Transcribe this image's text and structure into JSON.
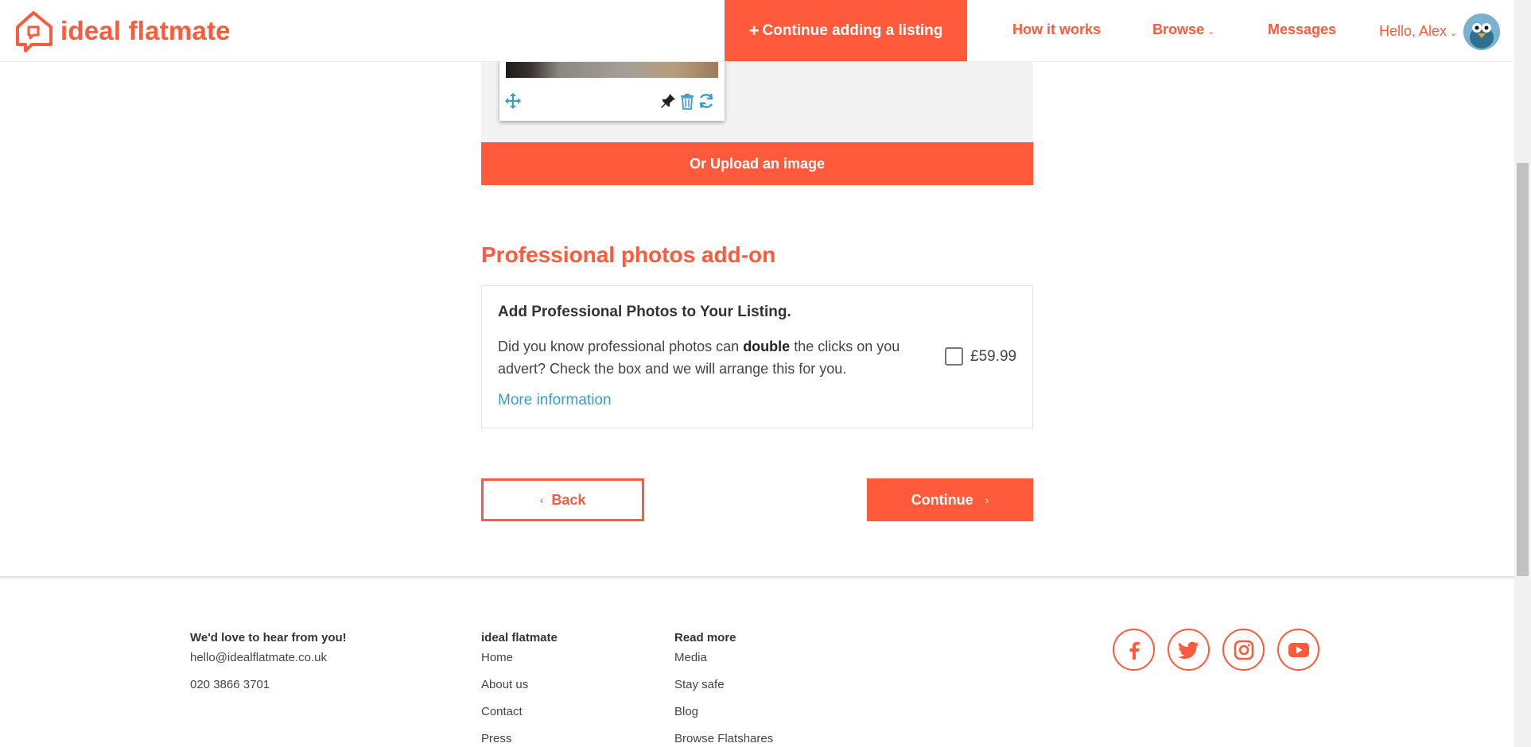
{
  "header": {
    "logo_text": "ideal flatmate",
    "cta_label": "Continue adding a listing",
    "nav": {
      "how_it_works": "How it works",
      "browse": "Browse",
      "messages": "Messages"
    },
    "greeting": "Hello, Alex"
  },
  "photo_upload": {
    "upload_label": "Or Upload an image"
  },
  "addon": {
    "section_title": "Professional photos add-on",
    "heading": "Add Professional Photos to Your Listing.",
    "desc_pre": "Did you know professional photos can ",
    "desc_bold": "double",
    "desc_post": " the clicks on you advert? Check the box and we will arrange this for you.",
    "more_info": "More information",
    "price": "£59.99",
    "checked": false
  },
  "actions": {
    "back_label": "Back",
    "continue_label": "Continue"
  },
  "footer": {
    "contact": {
      "heading": "We'd love to hear from you!",
      "email": "hello@idealflatmate.co.uk",
      "phone": "020 3866 3701"
    },
    "brand": {
      "heading": "ideal flatmate",
      "links": [
        "Home",
        "About us",
        "Contact",
        "Press"
      ]
    },
    "read_more": {
      "heading": "Read more",
      "links": [
        "Media",
        "Stay safe",
        "Blog",
        "Browse Flatshares"
      ]
    },
    "social": [
      "facebook-icon",
      "twitter-icon",
      "instagram-icon",
      "youtube-icon"
    ]
  },
  "colors": {
    "brand": "#ff5a3c",
    "link": "#3a9dc4"
  }
}
